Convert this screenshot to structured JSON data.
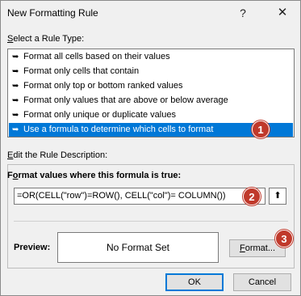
{
  "window": {
    "title": "New Formatting Rule",
    "help_label": "?",
    "close_label": "✕"
  },
  "rule_type": {
    "label": "Select a Rule Type:",
    "label_prefix": "S",
    "label_rest": "elect a Rule Type:",
    "arrow": "➥",
    "items": [
      {
        "label": "Format all cells based on their values"
      },
      {
        "label": "Format only cells that contain"
      },
      {
        "label": "Format only top or bottom ranked values"
      },
      {
        "label": "Format only values that are above or below average"
      },
      {
        "label": "Format only unique or duplicate values"
      },
      {
        "label": "Use a formula to determine which cells to format",
        "selected": true
      }
    ]
  },
  "description": {
    "label_prefix": "E",
    "label_rest": "dit the Rule Description:",
    "formula_label_prefix": "F",
    "formula_label_mid": "o",
    "formula_label_rest": "rmat values where this formula is true:",
    "formula_value": "=OR(CELL(\"row\")=ROW(), CELL(\"col\")= COLUMN())",
    "collapse_icon": "⬆",
    "preview_label": "Preview:",
    "preview_text": "No Format Set",
    "format_button_prefix": "F",
    "format_button_rest": "ormat..."
  },
  "buttons": {
    "ok": "OK",
    "cancel": "Cancel"
  },
  "badges": [
    "1",
    "2",
    "3"
  ],
  "colors": {
    "selection": "#0078d7",
    "badge": "#c0392b"
  }
}
